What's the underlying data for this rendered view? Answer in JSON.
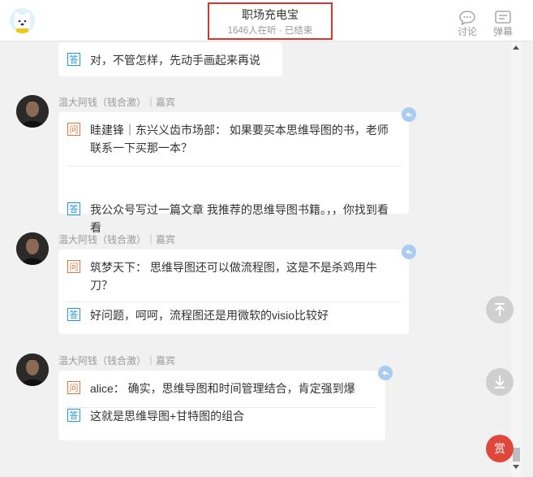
{
  "header": {
    "title": "职场充电宝",
    "subtitle": "1646人在听 · 已结束",
    "discuss_label": "讨论",
    "danmaku_label": "弹幕"
  },
  "tags": {
    "question": "问",
    "answer": "答"
  },
  "first_answer": "对，不管怎样，先动手画起来再说",
  "messages": [
    {
      "speaker": "温大阿钱（钱合激）｜嘉宾",
      "question": "眭建锋｜东兴义齿市场部： 如果要买本思维导图的书，老师联系一下买那一本？",
      "answer": "我公众号写过一篇文章 我推荐的思维导图书籍。，，你找到看看"
    },
    {
      "speaker": "温大阿钱（钱合激）｜嘉宾",
      "question": "筑梦天下： 思维导图还可以做流程图，这是不是杀鸡用牛刀？",
      "answer": "好问题，呵呵，流程图还是用微软的visio比较好"
    },
    {
      "speaker": "温大阿钱（钱合激）｜嘉宾",
      "question": "alice： 确实，思维导图和时间管理结合，肯定强到爆",
      "answer": "这就是思维导图+甘特图的组合"
    }
  ],
  "reward_label": "赏"
}
